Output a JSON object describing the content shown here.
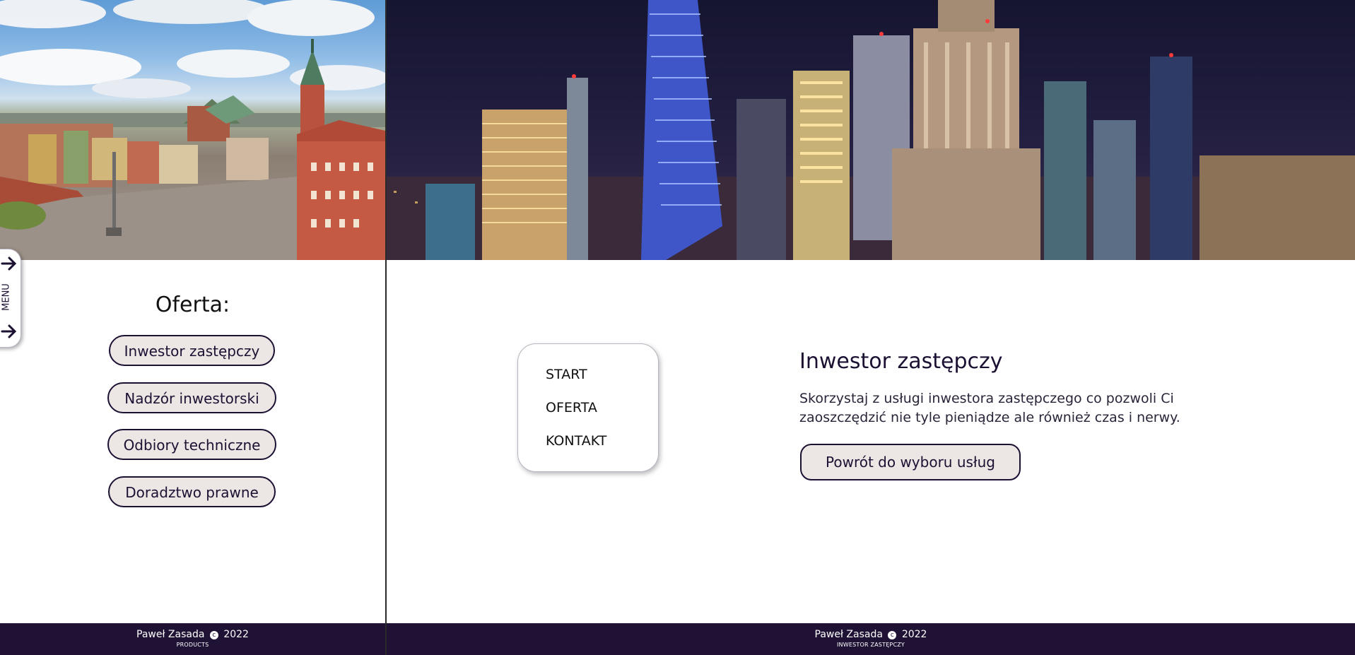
{
  "left": {
    "menu_tab_label": "MENU",
    "offer_heading": "Oferta:",
    "offer_buttons": [
      "Inwestor zastępczy",
      "Nadzór inwestorski",
      "Odbiory techniczne",
      "Doradztwo prawne"
    ],
    "footer": {
      "author": "Paweł Zasada",
      "copyright_symbol": "c",
      "year": "2022",
      "section": "PRODUCTS"
    }
  },
  "right": {
    "nav_links": [
      "START",
      "OFERTA",
      "KONTAKT"
    ],
    "service_title": "Inwestor zastępczy",
    "service_description": "Skorzystaj z usługi inwestora zastępczego co pozwoli Ci zaoszczędzić nie tyle pieniądze ale również czas i nerwy.",
    "back_button_label": "Powrót do wyboru usług",
    "footer": {
      "author": "Paweł Zasada",
      "copyright_symbol": "c",
      "year": "2022",
      "section": "INWESTOR ZASTĘPCZY"
    }
  },
  "colors": {
    "brand_dark": "#1f1235",
    "button_fill": "#ece6e4",
    "text": "#1c1133"
  },
  "icons": [
    "arrow-right-icon",
    "copyright-icon"
  ]
}
